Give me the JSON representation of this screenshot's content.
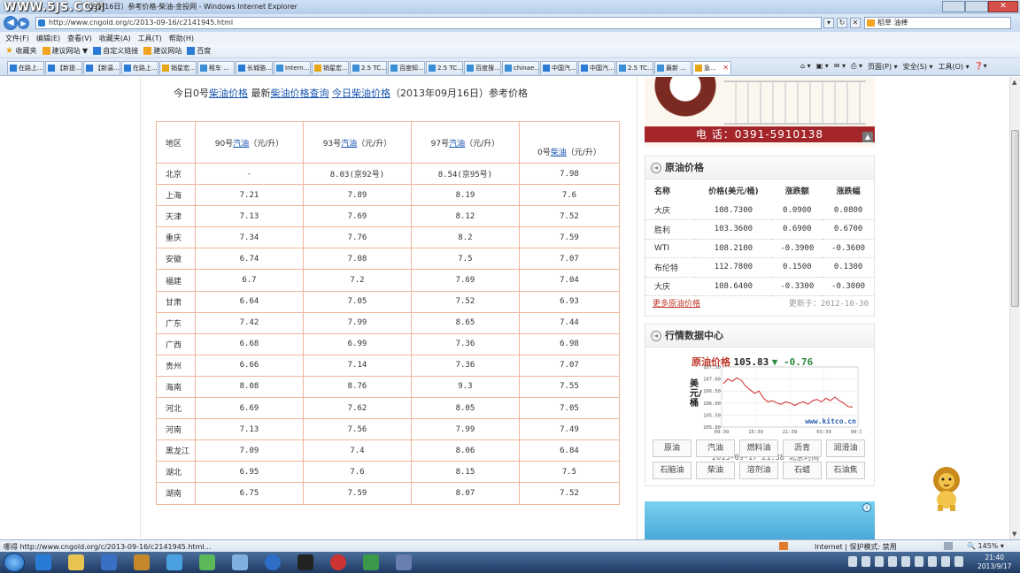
{
  "browser": {
    "watermark": "WWW.5JS.COM",
    "window_title": "09月16日）参考价格-柴油-金投网 - Windows Internet Explorer",
    "url": "http://www.cngold.org/c/2013-09-16/c2141945.html",
    "search_placeholder": "稻草 油棒",
    "menu": [
      "文件(F)",
      "编辑(E)",
      "查看(V)",
      "收藏夹(A)",
      "工具(T)",
      "帮助(H)"
    ],
    "favorites": [
      "收藏夹",
      "建议网站 ▼",
      "自定义链接",
      "建议网站",
      "百度"
    ],
    "tabs": [
      "在路上...",
      "【新提...",
      "【新温...",
      "在路上...",
      "销星宏...",
      "租车 ...",
      "长城骆...",
      "Intern...",
      "销星宏...",
      "2.5 TC...",
      "百度知...",
      "2.5 TC...",
      "百度搜...",
      "chinae...",
      "中国汽...",
      "中国汽...",
      "2.5 TC...",
      "最新 ...",
      "急..."
    ],
    "tab_tools": [
      "页面(P) ▾",
      "安全(S) ▾",
      "工具(O) ▾"
    ],
    "status_text": "哪得 http://www.cngold.org/c/2013-09-16/c2141945.html...",
    "status_zone": "Internet | 保护模式: 禁用",
    "zoom": "145%",
    "clock_time": "21:40",
    "clock_date": "2013/9/17"
  },
  "article": {
    "headline_pre": "今日0号",
    "headline_link1": "柴油价格",
    "headline_mid": " 最新",
    "headline_link2": "柴油价格查询",
    "headline_sp": " ",
    "headline_link3": "今日柴油价格",
    "headline_post": "（2013年09月16日）参考价格"
  },
  "price_table": {
    "headers": {
      "region": "地区",
      "c1_pre": "90号",
      "c1_link": "汽油",
      "c1_post": "（元/升）",
      "c2_pre": "93号",
      "c2_link": "汽油",
      "c2_post": "（元/升）",
      "c3_pre": "97号",
      "c3_link": "汽油",
      "c3_post": "（元/升）",
      "c4_pre": "0号",
      "c4_link": "柴油",
      "c4_post": "（元/升）"
    },
    "rows": [
      [
        "北京",
        "-",
        "8.03(京92号)",
        "8.54(京95号)",
        "7.98"
      ],
      [
        "上海",
        "7.21",
        "7.89",
        "8.19",
        "7.6"
      ],
      [
        "天津",
        "7.13",
        "7.69",
        "8.12",
        "7.52"
      ],
      [
        "重庆",
        "7.34",
        "7.76",
        "8.2",
        "7.59"
      ],
      [
        "安徽",
        "6.74",
        "7.08",
        "7.5",
        "7.07"
      ],
      [
        "福建",
        "6.7",
        "7.2",
        "7.69",
        "7.04"
      ],
      [
        "甘肃",
        "6.64",
        "7.05",
        "7.52",
        "6.93"
      ],
      [
        "广东",
        "7.42",
        "7.99",
        "8.65",
        "7.44"
      ],
      [
        "广西",
        "6.68",
        "6.99",
        "7.36",
        "6.98"
      ],
      [
        "贵州",
        "6.66",
        "7.14",
        "7.36",
        "7.07"
      ],
      [
        "海南",
        "8.08",
        "8.76",
        "9.3",
        "7.55"
      ],
      [
        "河北",
        "6.69",
        "7.62",
        "8.05",
        "7.05"
      ],
      [
        "河南",
        "7.13",
        "7.56",
        "7.99",
        "7.49"
      ],
      [
        "黑龙江",
        "7.09",
        "7.4",
        "8.06",
        "6.84"
      ],
      [
        "湖北",
        "6.95",
        "7.6",
        "8.15",
        "7.5"
      ],
      [
        "湖南",
        "6.75",
        "7.59",
        "8.07",
        "7.52"
      ]
    ]
  },
  "banner": {
    "phone": "电 话：0391-5910138"
  },
  "crude_panel": {
    "title": "原油价格",
    "headers": [
      "名称",
      "价格(美元/桶)",
      "涨跌额",
      "涨跌幅"
    ],
    "rows": [
      [
        "大庆",
        "108.7300",
        "0.0900",
        "0.0800"
      ],
      [
        "胜利",
        "103.3600",
        "0.6900",
        "0.6700"
      ],
      [
        "WTI",
        "108.2100",
        "-0.3900",
        "-0.3600"
      ],
      [
        "布伦特",
        "112.7800",
        "0.1500",
        "0.1300"
      ],
      [
        "大庆",
        "108.6400",
        "-0.3300",
        "-0.3000"
      ]
    ],
    "more_link": "更多原油价格",
    "updated": "更新于：2012-10-30"
  },
  "market_panel": {
    "title": "行情数据中心",
    "chart_title": "原油价格",
    "chart_value": "105.83",
    "chart_change": "▼ -0.76",
    "ylabel": "美元/桶",
    "watermark": "www.kitco.cn",
    "timestamp": "2013-09-17  21:38 北京时间",
    "tags": [
      "原油",
      "汽油",
      "燃料油",
      "沥青",
      "润滑油",
      "石脑油",
      "柴油",
      "溶剂油",
      "石蜡",
      "石油焦"
    ]
  },
  "chart_data": {
    "type": "line",
    "title": "原油价格",
    "ylabel": "美元/桶",
    "ylim": [
      105.0,
      107.5
    ],
    "yticks": [
      107.5,
      107.0,
      106.5,
      106.0,
      105.5,
      105.0
    ],
    "xticks": [
      "09:39",
      "15:39",
      "21:39",
      "03:39",
      "09:37"
    ],
    "series": [
      {
        "values": [
          106.8,
          107.0,
          106.9,
          107.05,
          106.95,
          106.7,
          106.55,
          106.4,
          106.5,
          106.2,
          106.05,
          106.1,
          106.0,
          105.95,
          106.05,
          106.0,
          105.9,
          106.0,
          106.05,
          105.95,
          106.1,
          106.15,
          106.05,
          106.2,
          106.1,
          106.25,
          106.1,
          106.0,
          105.85,
          105.83
        ]
      }
    ]
  },
  "colors": {
    "link": "#1a56b0",
    "table_border": "#f0b69b",
    "banner_red": "#a5262a",
    "price_red": "#c0392b",
    "down_green": "#2b8a3e"
  }
}
